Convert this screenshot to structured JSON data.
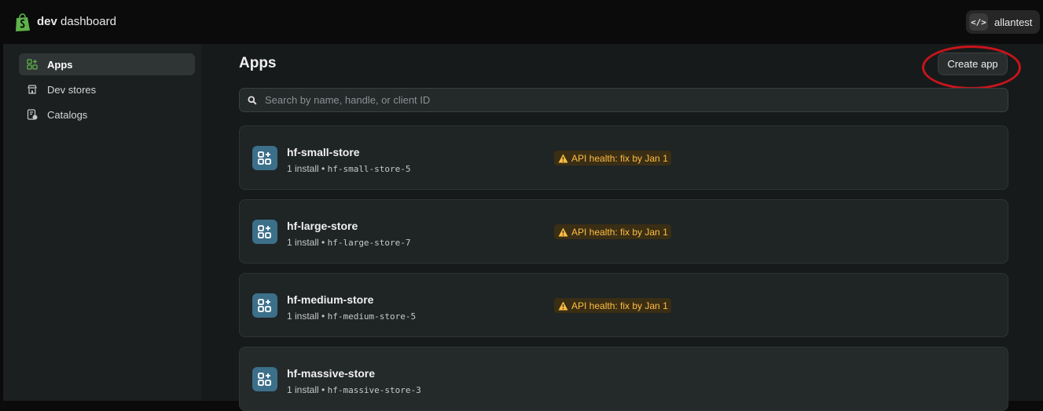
{
  "header": {
    "brand_bold": "dev",
    "brand_rest": "dashboard",
    "user_icon_text": "</>",
    "user_name": "allantest"
  },
  "sidebar": {
    "items": [
      {
        "label": "Apps",
        "icon": "apps-icon",
        "active": true
      },
      {
        "label": "Dev stores",
        "icon": "store-icon",
        "active": false
      },
      {
        "label": "Catalogs",
        "icon": "catalog-icon",
        "active": false
      }
    ]
  },
  "main": {
    "title": "Apps",
    "create_button": "Create app",
    "search_placeholder": "Search by name, handle, or client ID"
  },
  "apps": [
    {
      "name": "hf-small-store",
      "installs": "1 install",
      "separator": "•",
      "handle": "hf-small-store-5",
      "badge": "API health: fix by Jan 1"
    },
    {
      "name": "hf-large-store",
      "installs": "1 install",
      "separator": "•",
      "handle": "hf-large-store-7",
      "badge": "API health: fix by Jan 1"
    },
    {
      "name": "hf-medium-store",
      "installs": "1 install",
      "separator": "•",
      "handle": "hf-medium-store-5",
      "badge": "API health: fix by Jan 1"
    },
    {
      "name": "hf-massive-store",
      "installs": "1 install",
      "separator": "•",
      "handle": "hf-massive-store-3",
      "badge": ""
    }
  ],
  "colors": {
    "accent_green": "#5eb34a",
    "warning_text": "#ffbe45",
    "app_icon_bg": "#3c6f8a",
    "highlight": "#c8141a"
  }
}
